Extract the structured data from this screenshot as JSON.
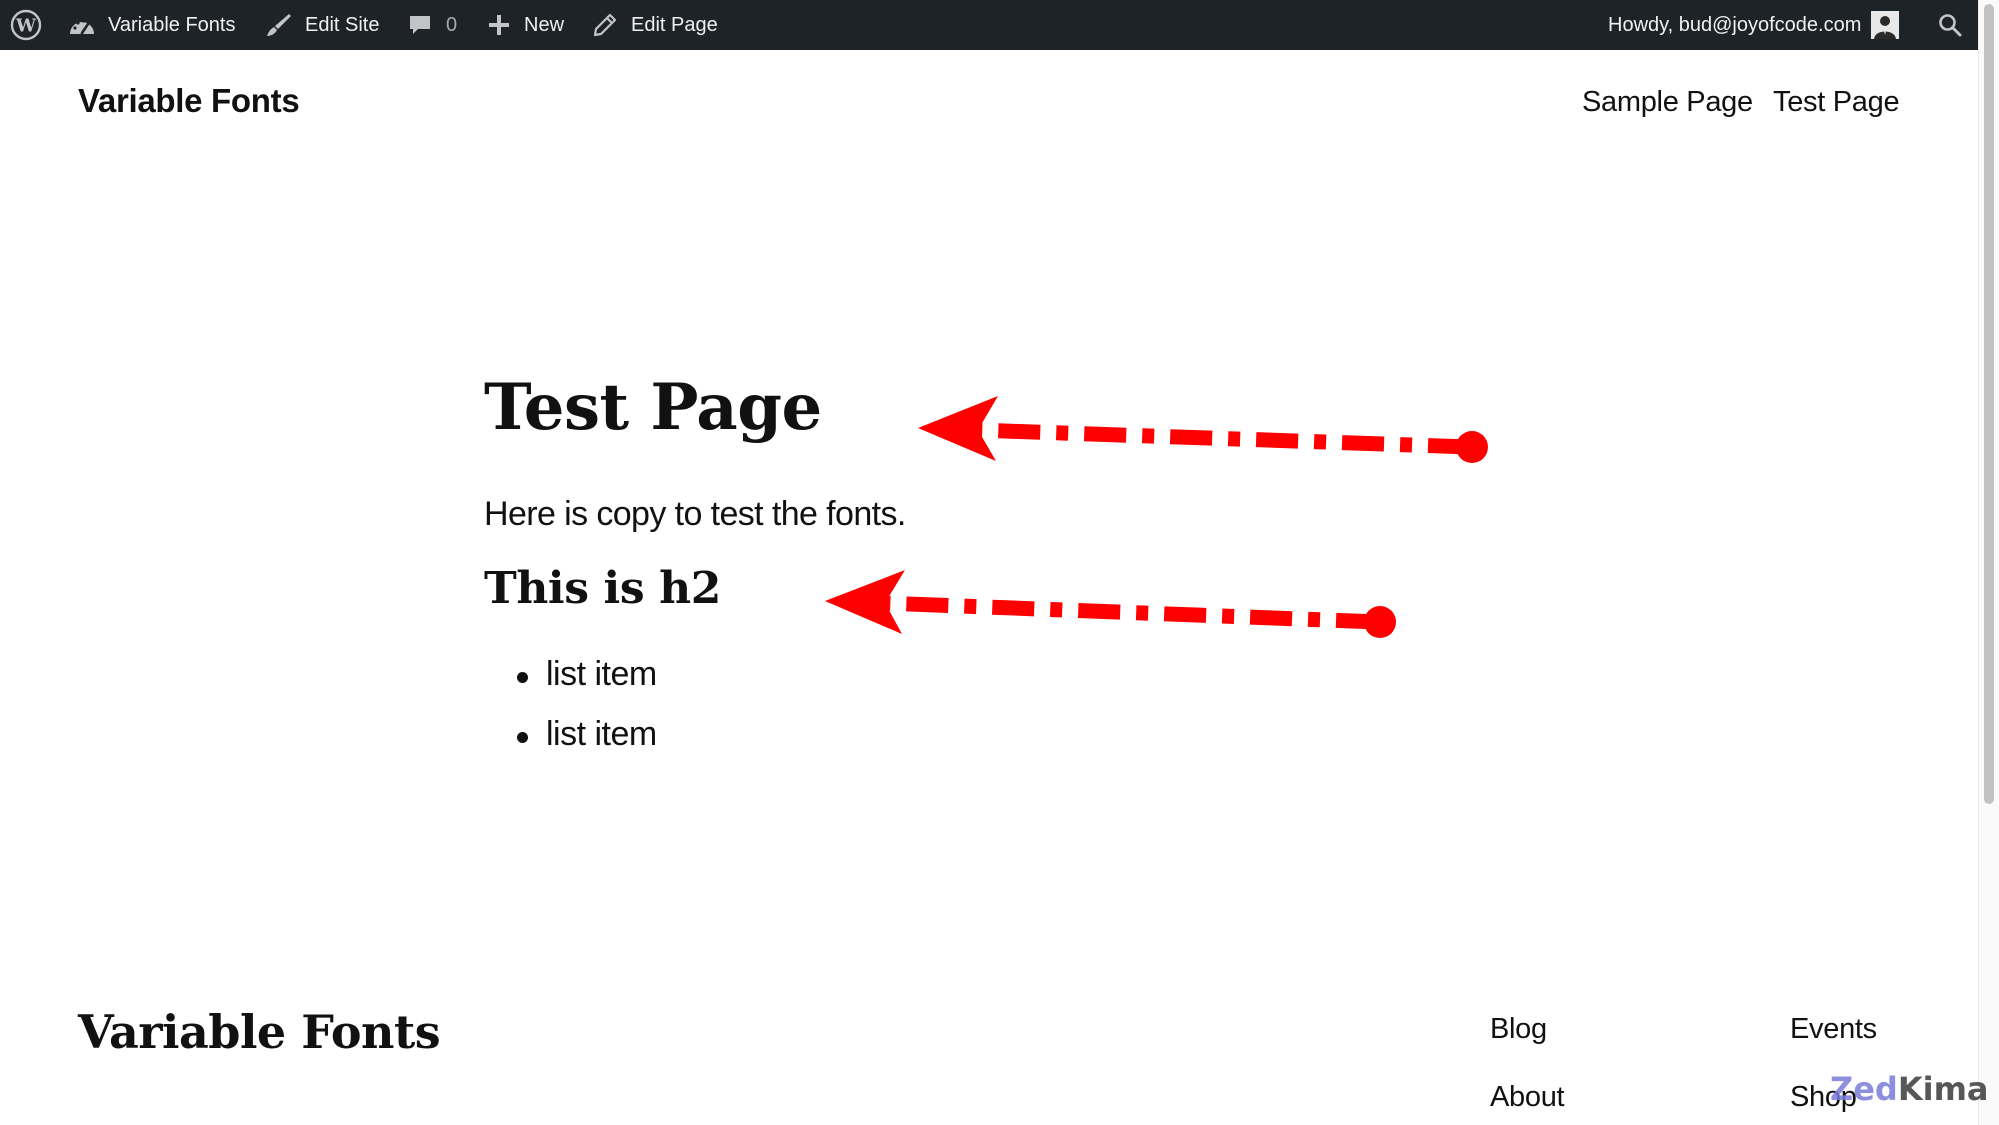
{
  "admin_bar": {
    "site_name": "Variable Fonts",
    "edit_site": "Edit Site",
    "comments_count": "0",
    "new_label": "New",
    "edit_page": "Edit Page",
    "howdy": "Howdy, bud@joyofcode.com"
  },
  "header": {
    "site_title": "Variable Fonts",
    "nav": [
      "Sample Page",
      "Test Page"
    ]
  },
  "content": {
    "title": "Test Page",
    "paragraph": "Here is copy to test the fonts.",
    "h2": "This is h2",
    "list_items": [
      "list item",
      "list item"
    ]
  },
  "footer": {
    "site_title": "Variable Fonts",
    "links": [
      "Blog",
      "Events",
      "About",
      "Shop"
    ]
  },
  "watermark": {
    "part1": "Zed",
    "part2": "Kima"
  },
  "colors": {
    "admin_bar_bg": "#1d2327",
    "annotation_red": "#ff0000"
  }
}
